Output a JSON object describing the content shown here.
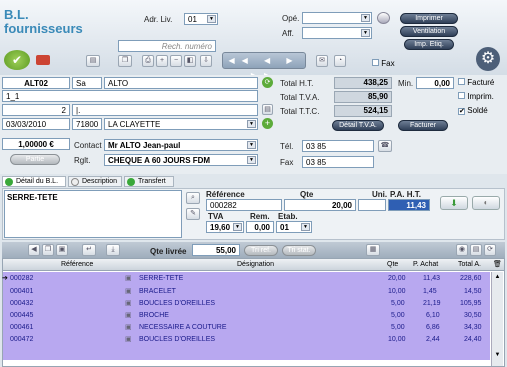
{
  "header": {
    "title_line1": "B.L.",
    "title_line2": "fournisseurs",
    "adr_liv_label": "Adr. Liv.",
    "adr_liv_value": "01",
    "ope_label": "Opé.",
    "aff_label": "Aff.",
    "fax_label": "Fax",
    "search_placeholder": "Rech. numéro",
    "btn_imprimer": "Imprimer",
    "btn_ventilation": "Ventilation",
    "btn_imp_etiq": "Imp. Etiq."
  },
  "supplier": {
    "code": "ALT02",
    "abbr": "Sa",
    "name": "ALTO",
    "line2": "1_1",
    "line3_num": "2",
    "line3_text": "|.",
    "date": "03/03/2010",
    "postcode": "71800",
    "city": "LA CLAYETTE",
    "rate": "1,00000 €",
    "btn_partie": "Partie",
    "contact_label": "Contact",
    "contact_value": "Mr ALTO Jean-paul",
    "rglt_label": "Rglt.",
    "rglt_value": "CHEQUE A 60 JOURS FDM",
    "tel_label": "Tél.",
    "tel_value": "03 85",
    "fax_label": "Fax",
    "fax_value": "03 85"
  },
  "totals": {
    "ht_label": "Total H.T.",
    "ht_value": "438,25",
    "tva_label": "Total T.V.A.",
    "tva_value": "85,90",
    "ttc_label": "Total T.T.C.",
    "ttc_value": "524,15",
    "min_label": "Min.",
    "min_value": "0,00",
    "facture_label": "Facturé",
    "imprim_label": "Imprim.",
    "solde_label": "Soldé",
    "btn_detail_tva": "Détail T.V.A.",
    "btn_facturer": "Facturer"
  },
  "tabs": [
    "Détail du B.L.",
    "Description",
    "Transfert"
  ],
  "detail": {
    "designation": "SERRE-TETE",
    "ref_label": "Référence",
    "ref_value": "000282",
    "qte_label": "Qte",
    "qte_value": "20,00",
    "uni_label": "Uni.",
    "pa_label": "P.A. H.T.",
    "pa_value": "11,43",
    "tva_label": "TVA",
    "tva_value": "19,60",
    "rem_label": "Rem.",
    "rem_value": "0,00",
    "etab_label": "Etab.",
    "etab_value": "01"
  },
  "grid_toolbar": {
    "qte_livree_label": "Qte livrée",
    "qte_livree_value": "55,00",
    "btn_tri_ref": "Tri ref.",
    "btn_tri_stat": "Tri stat."
  },
  "table": {
    "columns": [
      "Référence",
      "Désignation",
      "Qte",
      "P. Achat",
      "Total A."
    ],
    "rows": [
      {
        "ref": "000282",
        "designation": "SERRE-TETE",
        "qte": "20,00",
        "pa": "11,43",
        "total": "228,60"
      },
      {
        "ref": "000401",
        "designation": "BRACELET",
        "qte": "10,00",
        "pa": "1,45",
        "total": "14,50"
      },
      {
        "ref": "000432",
        "designation": "BOUCLES D'OREILLES",
        "qte": "5,00",
        "pa": "21,19",
        "total": "105,95"
      },
      {
        "ref": "000445",
        "designation": "BROCHE",
        "qte": "5,00",
        "pa": "6,10",
        "total": "30,50"
      },
      {
        "ref": "000461",
        "designation": "NECESSAIRE A COUTURE",
        "qte": "5,00",
        "pa": "6,86",
        "total": "34,30"
      },
      {
        "ref": "000472",
        "designation": "BOUCLES D'OREILLES",
        "qte": "10,00",
        "pa": "2,44",
        "total": "24,40"
      }
    ]
  },
  "colors": {
    "accent": "#3a8ab8",
    "row_highlight": "#b8a8f0",
    "button_dark": "#2f3f58"
  }
}
